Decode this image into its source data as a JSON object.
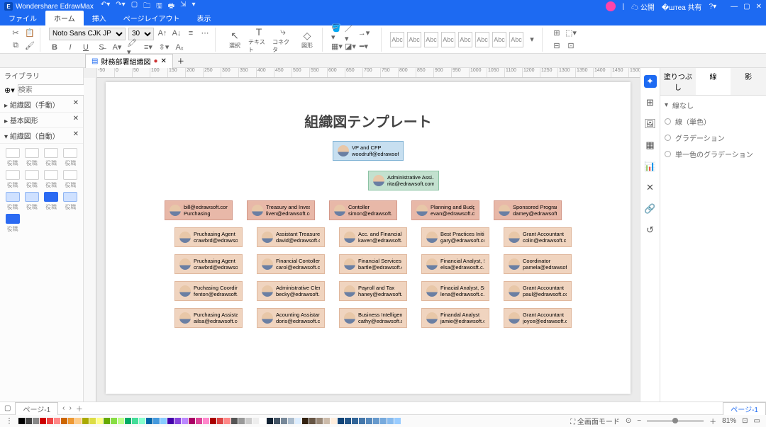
{
  "app": {
    "name": "Wondershare EdrawMax"
  },
  "titlebar": {
    "right": {
      "public": "公開",
      "share": "共有"
    }
  },
  "menu": {
    "file": "ファイル",
    "home": "ホーム",
    "insert": "挿入",
    "pagelayout": "ページレイアウト",
    "view": "表示"
  },
  "ribbon": {
    "font": "Noto Sans CJK JP Black",
    "size": "30",
    "select": "選択",
    "text": "テキスト",
    "connector": "コネクタ",
    "shape": "図形",
    "styleLabel": "Abc"
  },
  "docTab": {
    "name": "財務部署組織図"
  },
  "library": {
    "title": "ライブラリ",
    "search": "検索",
    "sections": [
      "組織図（手動）",
      "基本図形",
      "組織図（自動）"
    ],
    "cellLabel": "役職"
  },
  "propPanel": {
    "tabs": [
      "塗りつぶし",
      "線",
      "影"
    ],
    "none": "線なし",
    "solid": "線（単色）",
    "gradient": "グラデーション",
    "mono": "単一色のグラデーション"
  },
  "statusbar": {
    "fullscreen": "全画面モード",
    "zoom": "81%",
    "page": "ページ-1"
  },
  "chart": {
    "title": "組織図テンプレート",
    "root": {
      "title": "VP and CFP",
      "email": "woodruff@edrawsoft..."
    },
    "assistant": {
      "title": "Administrative Assi...",
      "email": "rita@edrawsoft.com"
    },
    "branches": [
      {
        "head": {
          "title": "bill@edrawsoft.com",
          "email": "Purchasing"
        },
        "subs": [
          {
            "title": "Pruchasing Agent",
            "email": "crawbrd@edrawsoft..."
          },
          {
            "title": "Pruchasing Agent",
            "email": "crawbrd@edrawsoft..."
          },
          {
            "title": "Puchasing Coordinator",
            "email": "fenton@edrawsoft.c..."
          },
          {
            "title": "Purchasing Assistant",
            "email": "ailsa@edrawsoft.com"
          }
        ]
      },
      {
        "head": {
          "title": "Treasury and Invest...",
          "email": "liven@edrawsoft.com"
        },
        "subs": [
          {
            "title": "Assistant Treasurer",
            "email": "david@edrawsoft.c..."
          },
          {
            "title": "Financial Contoller",
            "email": "carol@edrawsoft.c..."
          },
          {
            "title": "Administrative Clerk",
            "email": "becky@edrawsoft.c..."
          },
          {
            "title": "Acounting Assistant",
            "email": "doris@edrawsoft.c..."
          }
        ]
      },
      {
        "head": {
          "title": "Contoller",
          "email": "simon@edrawsoft.com"
        },
        "subs": [
          {
            "title": "Acc. and Financial ...",
            "email": "kaven@edrawsoft.c..."
          },
          {
            "title": "Financial Services",
            "email": "bartle@edrawsoft.c..."
          },
          {
            "title": "Payroll and Tax",
            "email": "haney@edrawsoft.c..."
          },
          {
            "title": "Business Intelligenc...",
            "email": "cathy@edrawsoft.c..."
          }
        ]
      },
      {
        "head": {
          "title": "Planning and Budget",
          "email": "evan@edrawsoft.com"
        },
        "subs": [
          {
            "title": "Best Practices Initia...",
            "email": "gary@edrawsoft.com"
          },
          {
            "title": "Financial Analyst, Sr.",
            "email": "elsa@edrawosft.c..."
          },
          {
            "title": "Finacial Analyst, Sr.",
            "email": "lena@edrawsoft.c..."
          },
          {
            "title": "Finandal Analyst",
            "email": "jamie@edrawsoft.c..."
          }
        ]
      },
      {
        "head": {
          "title": "Sponsored Programs",
          "email": "damey@edrawsoft..."
        },
        "subs": [
          {
            "title": "Grant Accountant",
            "email": "colin@edrawsoft.c..."
          },
          {
            "title": "Coordinator",
            "email": "pamela@edrawsof..."
          },
          {
            "title": "Grant Accountant",
            "email": "paul@edrawsoft.com"
          },
          {
            "title": "Grant Accountant",
            "email": "joyce@edrawsoft.c..."
          }
        ]
      }
    ]
  },
  "ruler": [
    "-50",
    "0",
    "50",
    "100",
    "150",
    "200",
    "250",
    "300",
    "350",
    "400",
    "450",
    "500",
    "550",
    "600",
    "650",
    "700",
    "750",
    "800",
    "850",
    "900",
    "950",
    "1000",
    "1050",
    "1100",
    "1200",
    "1250",
    "1300",
    "1350",
    "1400",
    "1450",
    "1500"
  ],
  "palette": [
    "#000",
    "#444",
    "#888",
    "#c00",
    "#e44",
    "#f88",
    "#c60",
    "#e93",
    "#fc8",
    "#aa0",
    "#dd4",
    "#ff8",
    "#6a0",
    "#8d4",
    "#bf8",
    "#0a6",
    "#4d9",
    "#8fc",
    "#06a",
    "#49d",
    "#8cf",
    "#40a",
    "#84d",
    "#b8f",
    "#a06",
    "#d49",
    "#f8c",
    "#a00",
    "#d44",
    "#f88",
    "#555",
    "#999",
    "#ccc",
    "#eee",
    "#fff",
    "#123",
    "#456",
    "#789",
    "#abc",
    "#def",
    "#321",
    "#654",
    "#987",
    "#cba",
    "#fed",
    "#147",
    "#258",
    "#369",
    "#47a",
    "#58b",
    "#69c",
    "#7ad",
    "#8be",
    "#9cf"
  ]
}
